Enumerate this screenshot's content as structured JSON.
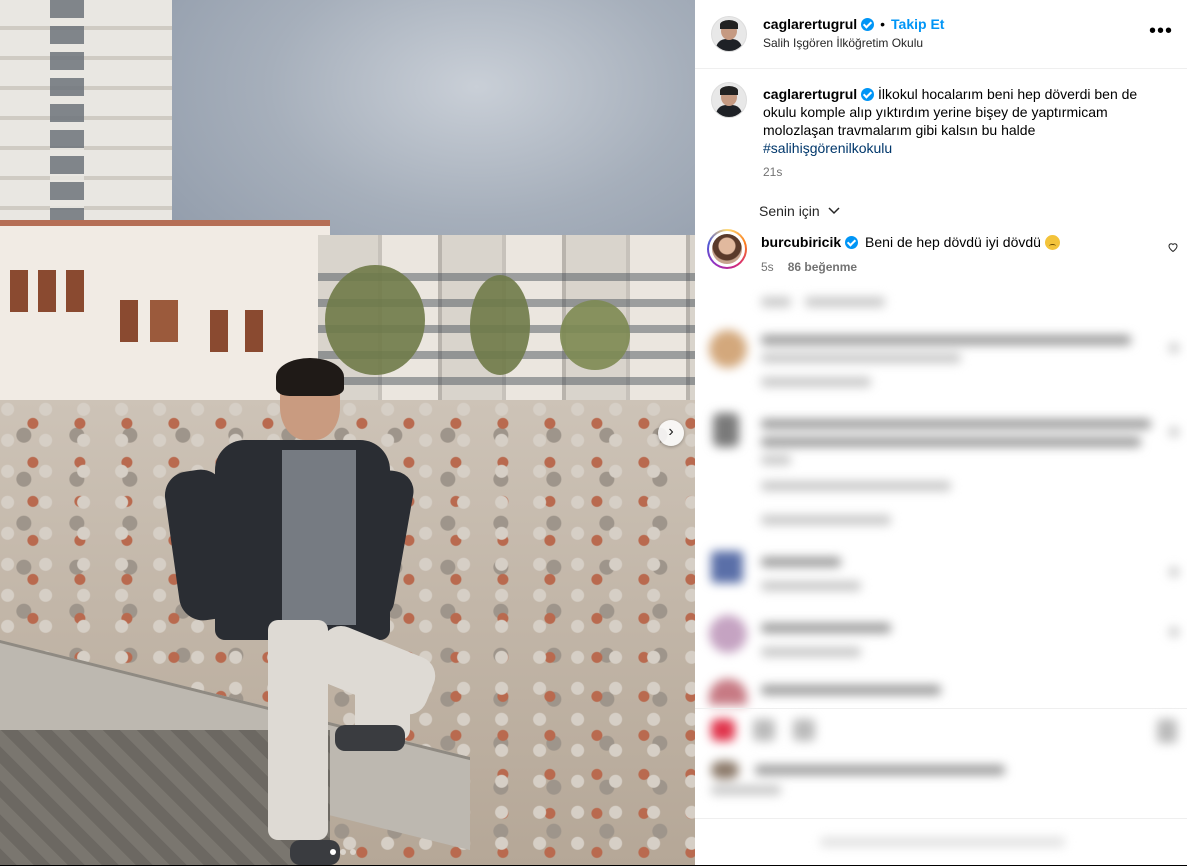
{
  "post": {
    "author": "caglarertugrul",
    "follow_label": "Takip Et",
    "separator": "•",
    "location": "Salih Işgören İlköğretim Okulu",
    "caption_text": "İlkokul hocalarım beni hep döverdi ben de okulu komple alıp yıktırdım yerine bişey de yaptırmicam molozlaşan travmalarım gibi kalsın bu halde",
    "hashtag": "#salihişgörenilkokulu",
    "time": "21s",
    "more_label": "•••"
  },
  "comments": {
    "sort_label": "Senin için",
    "first": {
      "author": "burcubiricik",
      "text": "Beni de hep dövdü iyi dövdü",
      "time": "5s",
      "likes": "86 beğenme"
    }
  },
  "photo": {
    "next_icon": "›",
    "slide_count": 3,
    "active_slide": 1
  },
  "colors": {
    "accent": "#0095f6",
    "hashtag": "#00376b",
    "muted": "#737373"
  }
}
